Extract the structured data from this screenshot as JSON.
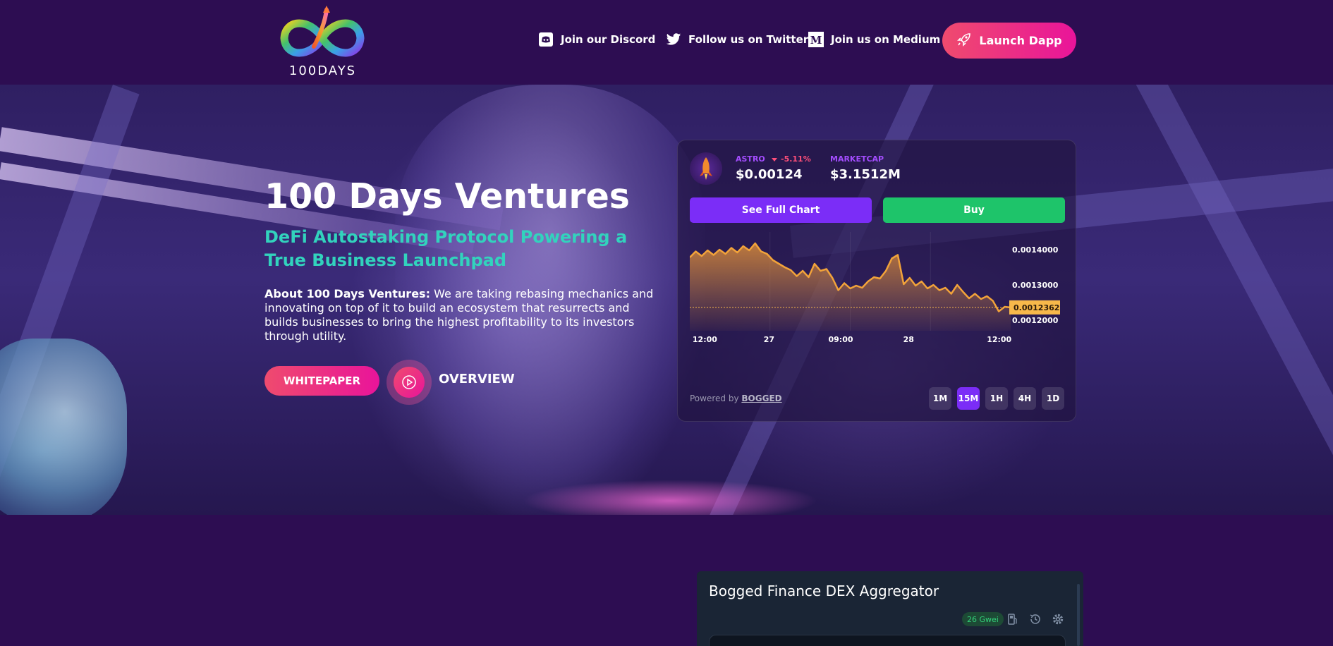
{
  "header": {
    "logo_text": "100DAYS",
    "nav": [
      {
        "label": "Join our Discord",
        "icon": "discord-icon"
      },
      {
        "label": "Follow us on Twitter",
        "icon": "twitter-icon"
      },
      {
        "label": "Join us on Medium",
        "icon": "medium-icon"
      }
    ],
    "launch_label": "Launch Dapp",
    "launch_icon": "rocket-icon"
  },
  "hero": {
    "title": "100 Days Ventures",
    "subtitle": "DeFi Autostaking Protocol Powering a True Business Launchpad",
    "about_label": "About 100 Days Ventures:",
    "about_text": "We are taking rebasing mechanics and innovating on top of it to build an ecosystem that resurrects and builds businesses to bring the highest profitability to its investors through utility.",
    "whitepaper_label": "WHITEPAPER",
    "overview_label": "OVERVIEW"
  },
  "price_card": {
    "symbol": "ASTRO",
    "change": "-5.11%",
    "price": "$0.00124",
    "marketcap_label": "MARKETCAP",
    "marketcap_value": "$3.1512M",
    "full_chart_label": "See Full Chart",
    "buy_label": "Buy",
    "powered_prefix": "Powered by",
    "powered_link": "BOGGED",
    "timeframes": [
      "1M",
      "15M",
      "1H",
      "4H",
      "1D"
    ],
    "active_timeframe": "15M"
  },
  "chart_data": {
    "type": "area",
    "x_ticks": [
      "12:00",
      "27",
      "09:00",
      "28",
      "12:00"
    ],
    "y_ticks": [
      "0.0014000",
      "0.0013000",
      "0.0012000"
    ],
    "ylim": [
      0.00117,
      0.00145
    ],
    "current_value": 0.0012362,
    "current_label": "0.0012362",
    "values": [
      0.001378,
      0.001395,
      0.001382,
      0.001398,
      0.001385,
      0.0014,
      0.001388,
      0.001405,
      0.001392,
      0.00141,
      0.001398,
      0.001418,
      0.001395,
      0.001388,
      0.00137,
      0.00136,
      0.00135,
      0.001342,
      0.001325,
      0.00134,
      0.001322,
      0.00136,
      0.00134,
      0.001345,
      0.00132,
      0.001285,
      0.001305,
      0.00129,
      0.001298,
      0.001292,
      0.00131,
      0.001322,
      0.001318,
      0.00134,
      0.001375,
      0.001385,
      0.001302,
      0.00132,
      0.001298,
      0.00131,
      0.00129,
      0.0013,
      0.001285,
      0.001292,
      0.001275,
      0.0013,
      0.00128,
      0.001262,
      0.001275,
      0.00126,
      0.001268,
      0.001255,
      0.001225,
      0.001238,
      0.001236
    ],
    "colors": {
      "line": "#f2a33a",
      "fill_top": "#d88a3a",
      "label_bg": "#f7b84a"
    }
  },
  "dex": {
    "title": "Bogged Finance DEX Aggregator",
    "gwei": "26 Gwei",
    "icons": [
      "gas-icon",
      "history-icon",
      "settings-icon"
    ]
  },
  "colors": {
    "background": "#2d0d52",
    "accent_pink": "#e9149a",
    "accent_teal": "#32d3bd",
    "purple": "#7b2df7",
    "green": "#1ec46a"
  }
}
